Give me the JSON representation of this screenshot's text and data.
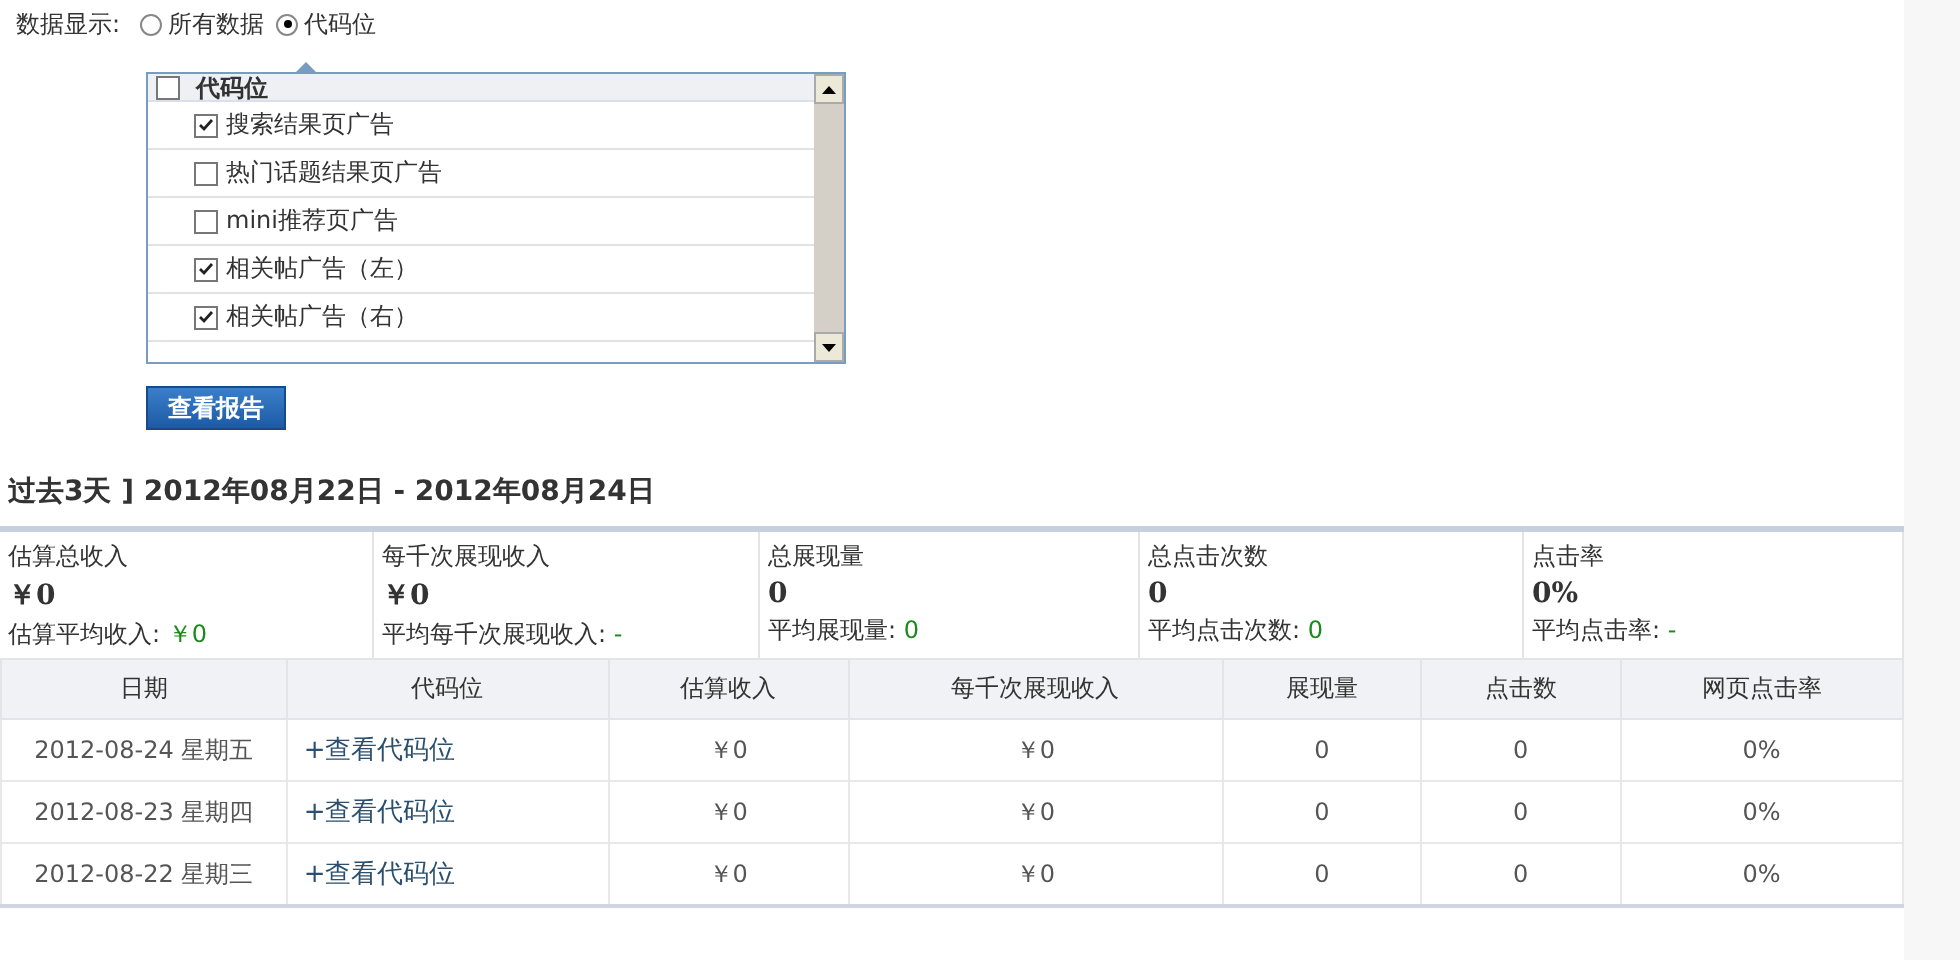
{
  "display_filter": {
    "label": "数据显示:",
    "options": [
      {
        "label": "所有数据",
        "selected": false
      },
      {
        "label": "代码位",
        "selected": true
      }
    ]
  },
  "ad_slot_list": {
    "group": {
      "label": "代码位",
      "checked": false
    },
    "items": [
      {
        "label": "搜索结果页广告",
        "checked": true
      },
      {
        "label": "热门话题结果页广告",
        "checked": false
      },
      {
        "label": "mini推荐页广告",
        "checked": false
      },
      {
        "label": "相关帖广告（左）",
        "checked": true
      },
      {
        "label": "相关帖广告（右）",
        "checked": true
      }
    ]
  },
  "report_button": "查看报告",
  "period_title": "过去3天 ] 2012年08月22日 - 2012年08月24日",
  "summary": [
    {
      "label": "估算总收入",
      "value": "￥0",
      "avg_label": "估算平均收入:",
      "avg_value": "￥0"
    },
    {
      "label": "每千次展现收入",
      "value": "￥0",
      "avg_label": "平均每千次展现收入:",
      "avg_value": "-"
    },
    {
      "label": "总展现量",
      "value": "0",
      "avg_label": "平均展现量:",
      "avg_value": "0"
    },
    {
      "label": "总点击次数",
      "value": "0",
      "avg_label": "平均点击次数:",
      "avg_value": "0"
    },
    {
      "label": "点击率",
      "value": "0%",
      "avg_label": "平均点击率:",
      "avg_value": "-"
    }
  ],
  "table": {
    "columns": [
      "日期",
      "代码位",
      "估算收入",
      "每千次展现收入",
      "展现量",
      "点击数",
      "网页点击率"
    ],
    "rows": [
      {
        "date": "2012-08-24 星期五",
        "link": "+查看代码位",
        "revenue": "￥0",
        "rpm": "￥0",
        "impressions": "0",
        "clicks": "0",
        "ctr": "0%"
      },
      {
        "date": "2012-08-23 星期四",
        "link": "+查看代码位",
        "revenue": "￥0",
        "rpm": "￥0",
        "impressions": "0",
        "clicks": "0",
        "ctr": "0%"
      },
      {
        "date": "2012-08-22 星期三",
        "link": "+查看代码位",
        "revenue": "￥0",
        "rpm": "￥0",
        "impressions": "0",
        "clicks": "0",
        "ctr": "0%"
      }
    ]
  }
}
